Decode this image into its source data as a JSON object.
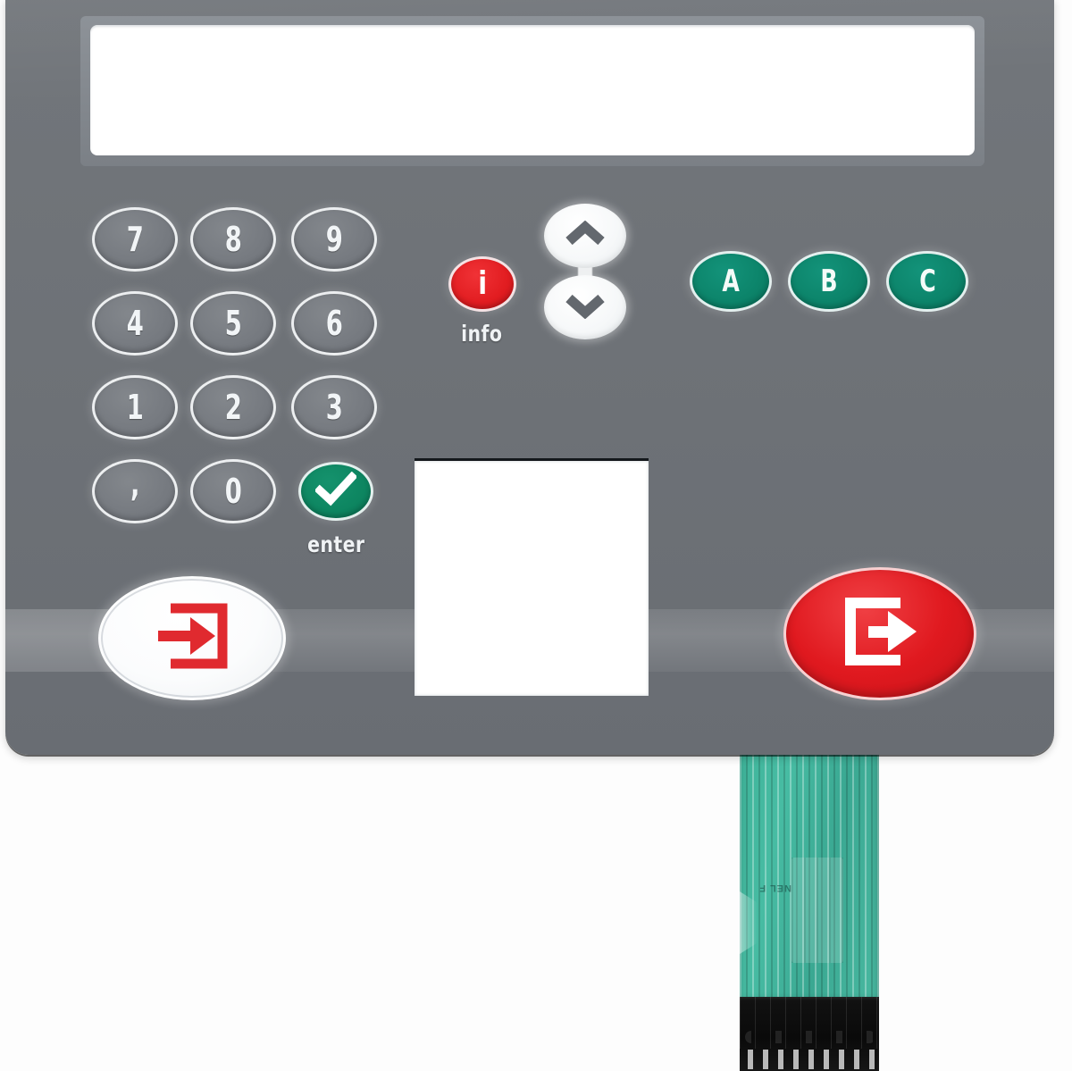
{
  "device": {
    "name": "Membrane Keypad Overlay",
    "panel_color": "#6e7277",
    "accent_red": "#e21d21",
    "accent_green": "#0c846a",
    "cable_color": "#3fb49a"
  },
  "display": {
    "name": "display-window",
    "content": ""
  },
  "keypad": {
    "rows": [
      [
        {
          "label": "7",
          "name": "key-7"
        },
        {
          "label": "8",
          "name": "key-8"
        },
        {
          "label": "9",
          "name": "key-9"
        }
      ],
      [
        {
          "label": "4",
          "name": "key-4"
        },
        {
          "label": "5",
          "name": "key-5"
        },
        {
          "label": "6",
          "name": "key-6"
        }
      ],
      [
        {
          "label": "1",
          "name": "key-1"
        },
        {
          "label": "2",
          "name": "key-2"
        },
        {
          "label": "3",
          "name": "key-3"
        }
      ],
      [
        {
          "label": ",",
          "name": "key-comma"
        },
        {
          "label": "0",
          "name": "key-0"
        }
      ]
    ],
    "enter": {
      "icon": "check-icon",
      "caption": "enter"
    }
  },
  "info": {
    "glyph": "i",
    "caption": "info"
  },
  "navigation": {
    "up": {
      "icon": "chevron-up-icon"
    },
    "down": {
      "icon": "chevron-down-icon"
    }
  },
  "function_keys": [
    {
      "label": "A",
      "name": "key-a"
    },
    {
      "label": "B",
      "name": "key-b"
    },
    {
      "label": "C",
      "name": "key-c"
    }
  ],
  "card_window": {
    "name": "card-reader-window",
    "content": ""
  },
  "action_buttons": {
    "login": {
      "icon": "login-arrow-icon",
      "color": "#e02a2f",
      "background": "#ffffff"
    },
    "logout": {
      "icon": "logout-arrow-icon",
      "color": "#ffffff",
      "background": "#e0191f"
    }
  },
  "cable": {
    "marking": "NEL F"
  }
}
